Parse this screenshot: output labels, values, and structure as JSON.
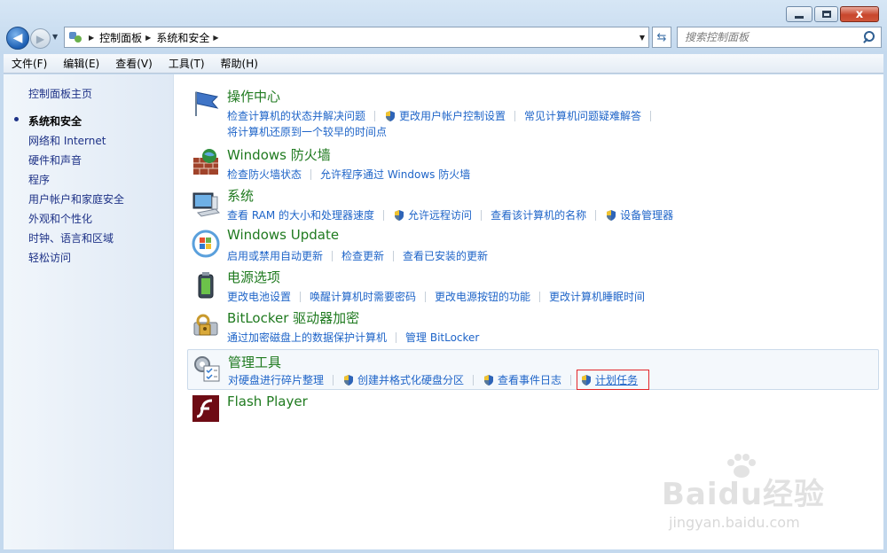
{
  "window": {
    "caption_close": "x"
  },
  "address": {
    "crumbs": [
      "控制面板",
      "系统和安全"
    ],
    "search_placeholder": "搜索控制面板"
  },
  "menubar": [
    "文件(F)",
    "编辑(E)",
    "查看(V)",
    "工具(T)",
    "帮助(H)"
  ],
  "nav": {
    "home": "控制面板主页",
    "items": [
      "系统和安全",
      "网络和 Internet",
      "硬件和声音",
      "程序",
      "用户帐户和家庭安全",
      "外观和个性化",
      "时钟、语言和区域",
      "轻松访问"
    ],
    "current_index": 0
  },
  "categories": [
    {
      "title": "操作中心",
      "icon": "action-center-flag-icon",
      "links": [
        {
          "label": "检查计算机的状态并解决问题",
          "shield": false
        },
        {
          "label": "更改用户帐户控制设置",
          "shield": true
        },
        {
          "label": "常见计算机问题疑难解答",
          "shield": false
        }
      ],
      "links2": [
        {
          "label": "将计算机还原到一个较早的时间点",
          "shield": false
        }
      ]
    },
    {
      "title": "Windows 防火墙",
      "icon": "firewall-icon",
      "links": [
        {
          "label": "检查防火墙状态",
          "shield": false
        },
        {
          "label": "允许程序通过 Windows 防火墙",
          "shield": false
        }
      ]
    },
    {
      "title": "系统",
      "icon": "system-computer-icon",
      "links": [
        {
          "label": "查看 RAM 的大小和处理器速度",
          "shield": false
        },
        {
          "label": "允许远程访问",
          "shield": true
        },
        {
          "label": "查看该计算机的名称",
          "shield": false
        },
        {
          "label": "设备管理器",
          "shield": true
        }
      ]
    },
    {
      "title": "Windows Update",
      "icon": "windows-update-icon",
      "links": [
        {
          "label": "启用或禁用自动更新",
          "shield": false
        },
        {
          "label": "检查更新",
          "shield": false
        },
        {
          "label": "查看已安装的更新",
          "shield": false
        }
      ]
    },
    {
      "title": "电源选项",
      "icon": "power-options-icon",
      "links": [
        {
          "label": "更改电池设置",
          "shield": false
        },
        {
          "label": "唤醒计算机时需要密码",
          "shield": false
        },
        {
          "label": "更改电源按钮的功能",
          "shield": false
        },
        {
          "label": "更改计算机睡眠时间",
          "shield": false
        }
      ]
    },
    {
      "title": "BitLocker 驱动器加密",
      "icon": "bitlocker-icon",
      "links": [
        {
          "label": "通过加密磁盘上的数据保护计算机",
          "shield": false
        },
        {
          "label": "管理 BitLocker",
          "shield": false
        }
      ]
    },
    {
      "title": "管理工具",
      "icon": "admin-tools-icon",
      "links": [
        {
          "label": "对硬盘进行碎片整理",
          "shield": false
        },
        {
          "label": "创建并格式化硬盘分区",
          "shield": true
        },
        {
          "label": "查看事件日志",
          "shield": true
        },
        {
          "label": "计划任务",
          "shield": true,
          "boxed": true
        }
      ]
    },
    {
      "title": "Flash Player",
      "icon": "flash-player-icon",
      "links": []
    }
  ],
  "watermark": {
    "text": "Baidu经验",
    "sub": "jingyan.baidu.com"
  },
  "colors": {
    "link": "#1e64c8",
    "category_title": "#1f7a1f",
    "nav_link": "#1e3287",
    "highlight_box": "#e3262a"
  }
}
